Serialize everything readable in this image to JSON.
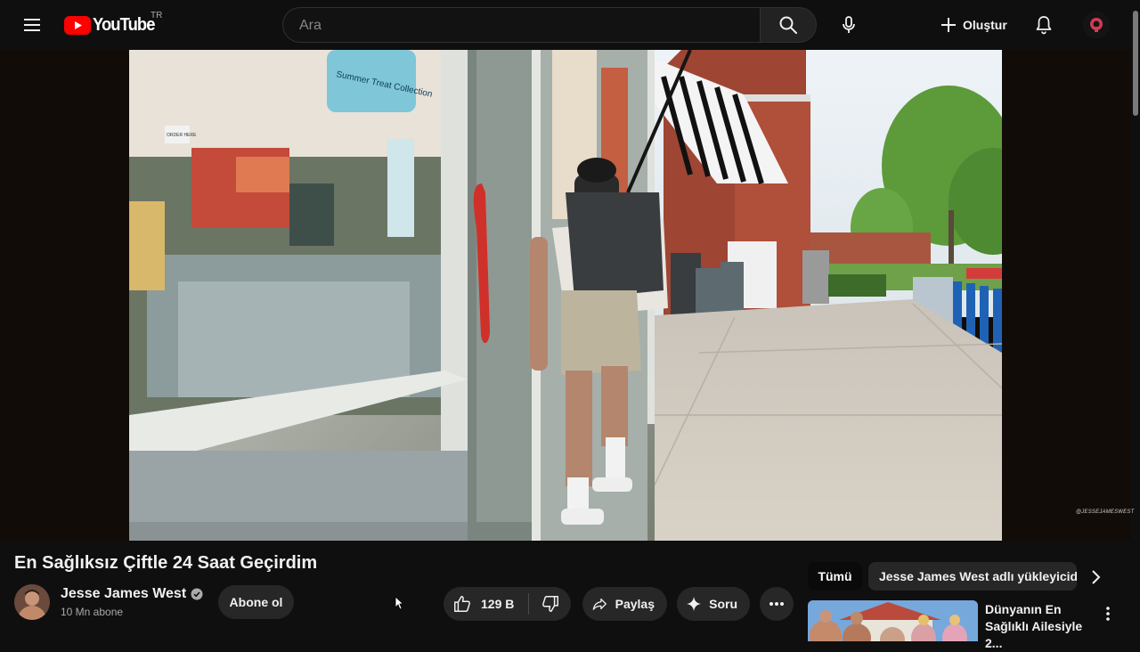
{
  "masthead": {
    "logo_text": "YouTube",
    "country_code": "TR",
    "search_placeholder": "Ara",
    "create_label": "Oluştur"
  },
  "video": {
    "title": "En Sağlıksız Çiftle 24 Saat Geçirdim",
    "watermark": "@JESSEJAMESWEST",
    "scene_texts": {
      "store_sign": "Summer Treat Collection",
      "door_label": "ORDER HERE"
    }
  },
  "owner": {
    "channel_name": "Jesse James West",
    "subscribers": "10 Mn abone",
    "subscribe_label": "Abone ol"
  },
  "actions": {
    "like_count": "129 B",
    "share_label": "Paylaş",
    "ask_label": "Soru"
  },
  "chips": {
    "all_label": "Tümü",
    "channel_label": "Jesse James West adlı yükleyiciden"
  },
  "recommendation": {
    "title": "Dünyanın En Sağlıklı Ailesiyle 2..."
  },
  "colors": {
    "background": "#0f0f0f",
    "brand_red": "#ff0000",
    "button_bg": "#272727",
    "text_primary": "#f1f1f1",
    "text_secondary": "#aaaaaa"
  }
}
